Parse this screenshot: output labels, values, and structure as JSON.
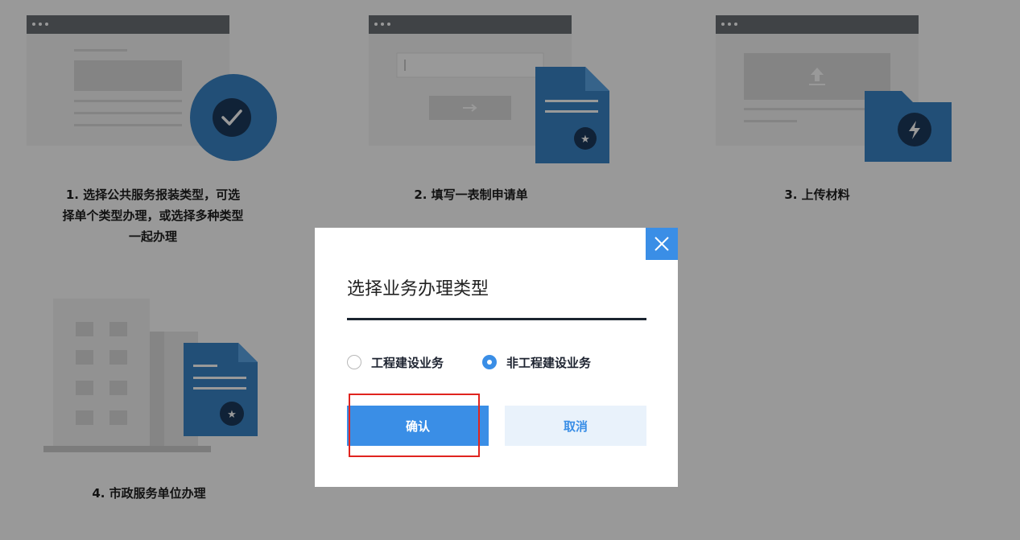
{
  "steps": [
    {
      "label_lines": [
        "1. 选择公共服务报装类型，可选",
        "择单个类型办理，或选择多种类型",
        "一起办理"
      ],
      "icon": "check-icon"
    },
    {
      "label_lines": [
        "2. 填写一表制申请单"
      ],
      "icon": "star-icon"
    },
    {
      "label_lines": [
        "3. 上传材料"
      ],
      "icon": "bolt-icon"
    },
    {
      "label_lines": [
        "4. 市政服务单位办理"
      ],
      "icon": "star-icon"
    }
  ],
  "dialog": {
    "title": "选择业务办理类型",
    "options": [
      {
        "label": "工程建设业务",
        "selected": false
      },
      {
        "label": "非工程建设业务",
        "selected": true
      }
    ],
    "confirm_label": "确认",
    "cancel_label": "取消"
  },
  "colors": {
    "accent": "#3a8ee6",
    "highlight": "#e0241f",
    "illustration_blue": "#3a84c6"
  }
}
